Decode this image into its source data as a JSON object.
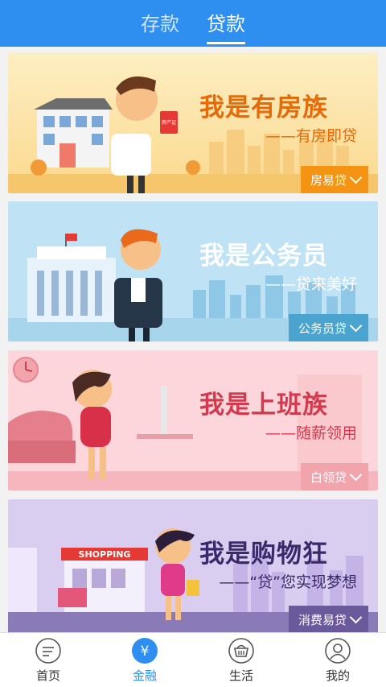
{
  "header": {
    "tabs": [
      {
        "label": "存款",
        "active": false
      },
      {
        "label": "贷款",
        "active": true
      }
    ],
    "background": "#2f8ff0"
  },
  "cards": [
    {
      "title": "我是有房族",
      "subtitle": "——有房即贷",
      "button": "房易贷",
      "bg": "#fde6a8",
      "title_color": "#e46a0a",
      "button_color": "#f59413",
      "illustration": {
        "badge": "房产证"
      }
    },
    {
      "title": "我是公务员",
      "subtitle": "——贷来美好",
      "button": "公务员贷",
      "bg": "#bfe3f4",
      "title_color": "#ffffff",
      "button_color": "#4aa4cf"
    },
    {
      "title": "我是上班族",
      "subtitle": "——随薪领用",
      "button": "白领贷",
      "bg": "#fcd6da",
      "title_color": "#d23b4f",
      "button_color": "#f2a4ad"
    },
    {
      "title": "我是购物狂",
      "subtitle": "——“贷”您实现梦想",
      "button": "消费易贷",
      "bg": "#d9cdf0",
      "title_color": "#3b2a6a",
      "button_color": "#6a5a9c",
      "illustration": {
        "sign": "SHOPPING"
      }
    }
  ],
  "bottom_nav": {
    "items": [
      {
        "label": "首页",
        "icon": "home-icon",
        "active": false
      },
      {
        "label": "金融",
        "icon": "yen-icon",
        "active": true
      },
      {
        "label": "生活",
        "icon": "basket-icon",
        "active": false
      },
      {
        "label": "我的",
        "icon": "user-icon",
        "active": false
      }
    ],
    "active_color": "#2f8ff0"
  }
}
